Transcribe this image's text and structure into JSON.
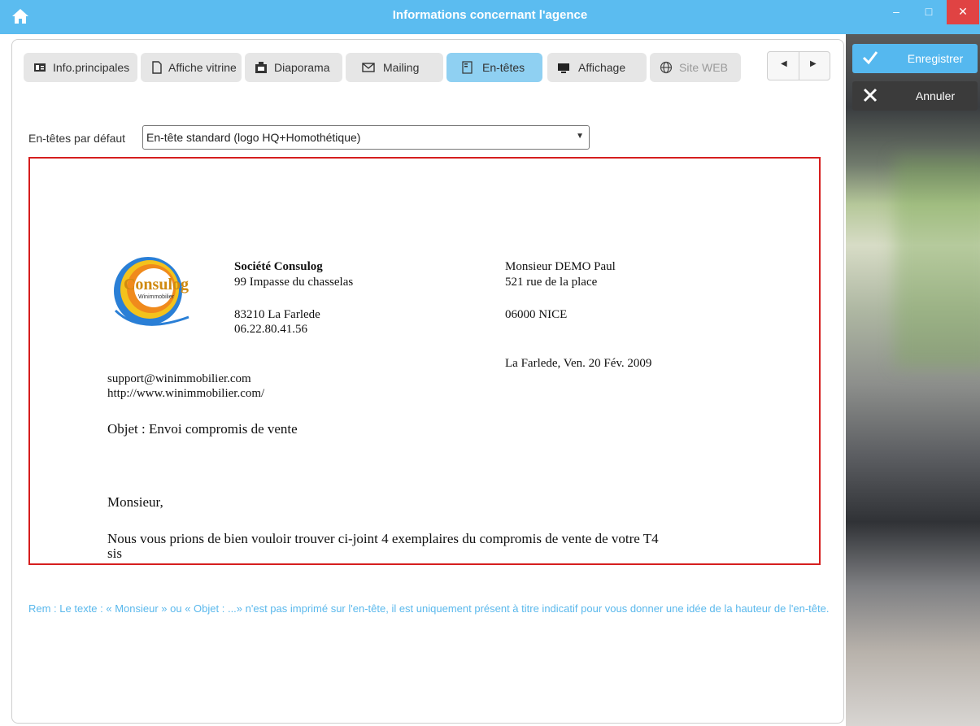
{
  "window": {
    "title": "Informations concernant l'agence"
  },
  "side": {
    "save_label": "Enregistrer",
    "cancel_label": "Annuler"
  },
  "tabs": [
    {
      "label": "Info.principales",
      "icon": "id-card-icon"
    },
    {
      "label": "Affiche vitrine",
      "icon": "document-icon"
    },
    {
      "label": "Diaporama",
      "icon": "projector-icon"
    },
    {
      "label": "Mailing",
      "icon": "envelope-icon"
    },
    {
      "label": "En-têtes",
      "icon": "header-doc-icon",
      "active": true
    },
    {
      "label": "Affichage",
      "icon": "monitor-icon"
    },
    {
      "label": "Site WEB",
      "icon": "globe-icon"
    }
  ],
  "headers": {
    "label": "En-têtes par défaut",
    "selected": "En-tête standard (logo HQ+Homothétique)"
  },
  "letter": {
    "logo_text": "Consulog",
    "logo_sub": "Winimmobilier",
    "company": "Société Consulog",
    "street": "99 Impasse du chasselas",
    "city": "83210 La Farlede",
    "phone": "06.22.80.41.56",
    "email": "support@winimmobilier.com",
    "website": "http://www.winimmobilier.com/",
    "recipient_name": "Monsieur DEMO Paul",
    "recipient_street": "521 rue de la place",
    "recipient_city": "06000 NICE",
    "place_date": "La Farlede, Ven. 20 Fév. 2009",
    "subject": "Objet : Envoi compromis de vente",
    "salutation": "Monsieur,",
    "body_line1": "Nous vous prions de bien vouloir trouver ci-joint 4 exemplaires du compromis de vente de votre T4",
    "body_line2": "sis"
  },
  "note": "Rem : Le texte : « Monsieur » ou « Objet : ...» n'est pas imprimé sur l'en-tête, il est uniquement présent à titre indicatif pour vous donner une idée de la hauteur de l'en-tête.",
  "colors": {
    "titlebar": "#5bbcf0",
    "accent": "#55b8ef",
    "active_tab": "#8fd0f2",
    "preview_border": "#d61e1e",
    "note": "#5ab8ec"
  }
}
